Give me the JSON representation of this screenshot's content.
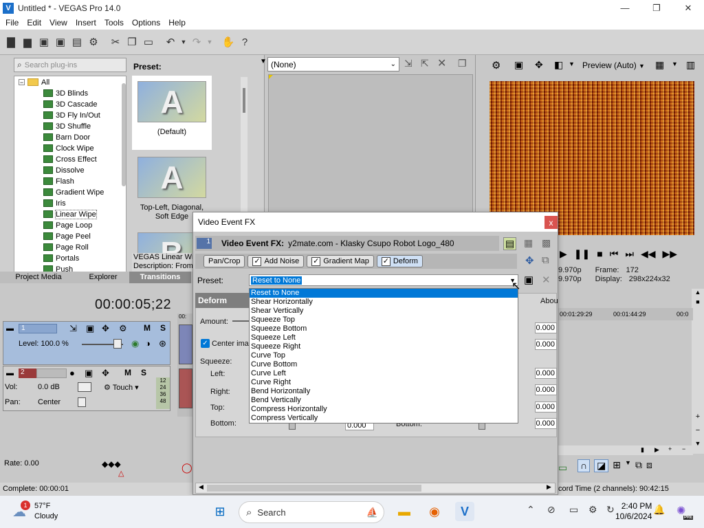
{
  "app": {
    "window_title": "Untitled * - VEGAS Pro 14.0",
    "logo_glyph": "V",
    "window_buttons": [
      "—",
      "❐",
      "✕"
    ]
  },
  "menu": [
    "File",
    "Edit",
    "View",
    "Insert",
    "Tools",
    "Options",
    "Help"
  ],
  "plugins": {
    "search_placeholder": "Search plug-ins",
    "root": "All",
    "items": [
      "3D Blinds",
      "3D Cascade",
      "3D Fly In/Out",
      "3D Shuffle",
      "Barn Door",
      "Clock Wipe",
      "Cross Effect",
      "Dissolve",
      "Flash",
      "Gradient Wipe",
      "Iris",
      "Linear Wipe",
      "Page Loop",
      "Page Peel",
      "Page Roll",
      "Portals",
      "Push"
    ],
    "selected": "Linear Wipe",
    "preset_label": "Preset:",
    "presets": [
      {
        "letter": "A",
        "label": "(Default)"
      },
      {
        "letter": "A",
        "label": "Top-Left, Diagonal, Soft Edge"
      },
      {
        "letter": "B",
        "label": ""
      }
    ],
    "description_line1": "VEGAS Linear Wipe",
    "description_line2": "Description: From",
    "tabs": [
      "Project Media",
      "Explorer",
      "Transitions"
    ],
    "active_tab": "Transitions"
  },
  "trimmer": {
    "select_value": "(None)"
  },
  "preview": {
    "quality": "Preview (Auto)",
    "frame_label": "Frame:",
    "frame_value": "172",
    "display_label": "Display:",
    "display_value": "298x224x32",
    "project_fps_1": "9.970p",
    "project_fps_2": "9.970p"
  },
  "timeline": {
    "timecode": "00:00:05;22",
    "track1": {
      "number": "1",
      "level": "Level: 100.0 %",
      "m": "M",
      "s": "S"
    },
    "track2": {
      "number": "2",
      "vol_label": "Vol:",
      "vol_value": "0.0 dB",
      "pan_label": "Pan:",
      "pan_value": "Center",
      "touch": "Touch",
      "m": "M",
      "s": "S"
    },
    "rate": "Rate: 0.00",
    "ruler": [
      "00:01:29:29",
      "00:01:44:29",
      "00:0"
    ],
    "status": "Complete: 00:00:01",
    "record_time": "cord Time (2 channels): 90:42:15",
    "head_marker": "00:"
  },
  "dialog": {
    "title": "Video Event FX",
    "close": "x",
    "fx_label": "Video Event FX:",
    "fx_source": "y2mate.com - Klasky Csupo Robot Logo_480",
    "fx_number": "1",
    "chain": [
      {
        "label": "Pan/Crop",
        "checked": false
      },
      {
        "label": "Add Noise",
        "checked": true
      },
      {
        "label": "Gradient Map",
        "checked": true
      },
      {
        "label": "Deform",
        "checked": true
      }
    ],
    "preset_label": "Preset:",
    "preset_value": "Reset to None",
    "dropdown": [
      "Reset to None",
      "Shear Horizontally",
      "Shear Vertically",
      "Squeeze Top",
      "Squeeze Bottom",
      "Squeeze Left",
      "Squeeze Right",
      "Curve Top",
      "Curve Bottom",
      "Curve Left",
      "Curve Right",
      "Bend Horizontally",
      "Bend Vertically",
      "Compress Horizontally",
      "Compress Vertically"
    ],
    "panel_title": "Deform",
    "about": "Abou",
    "amount_label": "Amount:",
    "center_label": "Center imag",
    "squeeze_label": "Squeeze:",
    "left_label": "Left:",
    "right_label": "Right:",
    "top_label": "Top:",
    "bottom_label": "Bottom:",
    "bottom2_label": "Bottom:",
    "value": "0.000",
    "values": [
      "0.000",
      "0.000",
      "0.000",
      "0.000",
      "0.000",
      "0.000",
      "0.000"
    ]
  },
  "taskbar": {
    "temp": "57°F",
    "condition": "Cloudy",
    "weather_badge": "1",
    "search": "Search",
    "time": "2:40 PM",
    "date": "10/6/2024",
    "copilot_badge": "PRE"
  },
  "colors": {
    "accent": "#0078d7",
    "dialog_close": "#d9534f"
  }
}
